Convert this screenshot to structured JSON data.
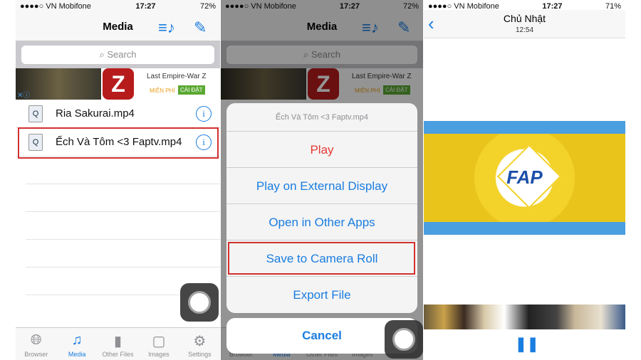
{
  "status": {
    "carrier": "●●●●○ VN Mobifone",
    "time": "17:27",
    "battery1": "72%",
    "battery3": "71%"
  },
  "media": {
    "title": "Media",
    "search_placeholder": "Search",
    "ad": {
      "title": "Last Empire-War Z",
      "free": "MIỄN PHÍ",
      "install": "CÀI ĐẶT",
      "icon_letter": "Z"
    },
    "files": [
      {
        "name": "Ria Sakurai.mp4"
      },
      {
        "name": "Ếch Và Tôm <3 Faptv.mp4"
      }
    ],
    "tabs": [
      {
        "label": "Browser",
        "icon": "globe-icon"
      },
      {
        "label": "Media",
        "icon": "music-note-icon"
      },
      {
        "label": "Other Files",
        "icon": "file-icon"
      },
      {
        "label": "Images",
        "icon": "picture-frame-icon"
      },
      {
        "label": "Settings",
        "icon": "gear-icon"
      }
    ]
  },
  "sheet": {
    "title": "Ếch Và Tôm <3 Faptv.mp4",
    "actions": [
      "Play",
      "Play on External Display",
      "Open in Other Apps",
      "Save to Camera Roll",
      "Export File"
    ],
    "cancel": "Cancel"
  },
  "player": {
    "title": "Chủ Nhật",
    "subtitle": "12:54",
    "logo": "FAP",
    "accent": "#1a7de0"
  }
}
